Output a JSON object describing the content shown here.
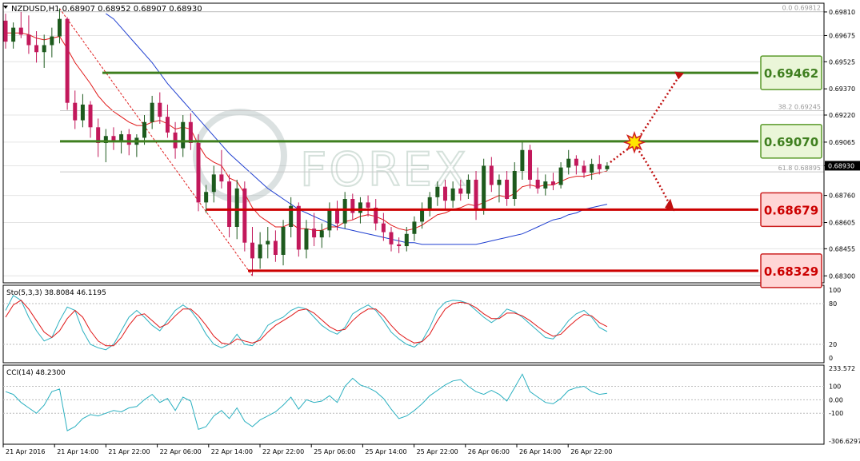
{
  "header": {
    "symbol_line": "NZDUSD,H1  0.68907 0.68952 0.68907 0.68930"
  },
  "chart_data": {
    "type": "candlestick",
    "symbol": "NZDUSD",
    "timeframe": "H1",
    "ohlc_label": "0.68907 0.68952 0.68907 0.68930",
    "ylim": [
      0.6826,
      0.6986
    ],
    "price_ticks": [
      "0.69810",
      "0.69675",
      "0.69525",
      "0.69370",
      "0.69220",
      "0.69065",
      "0.68930",
      "0.68760",
      "0.68605",
      "0.68455",
      "0.68300"
    ],
    "current_price": "0.68930",
    "x_labels": [
      "21 Apr 2016",
      "21 Apr 14:00",
      "21 Apr 22:00",
      "22 Apr 06:00",
      "22 Apr 14:00",
      "22 Apr 22:00",
      "25 Apr 06:00",
      "25 Apr 14:00",
      "25 Apr 22:00",
      "26 Apr 06:00",
      "26 Apr 14:00",
      "26 Apr 22:00"
    ],
    "fibonacci": [
      {
        "label": "0.0  0.69812",
        "price": 0.69812
      },
      {
        "label": "38.2  0.69245",
        "price": 0.69245
      },
      {
        "label": "61.8  0.68895",
        "price": 0.68895
      }
    ],
    "levels": [
      {
        "label": "0.69462",
        "price": 0.69462,
        "kind": "resistance",
        "color": "#3f7f1f",
        "fill": "#eaf6d8",
        "border": "#5a9a2a"
      },
      {
        "label": "0.69070",
        "price": 0.6907,
        "kind": "resistance",
        "color": "#3f7f1f",
        "fill": "#eaf6d8",
        "border": "#5a9a2a"
      },
      {
        "label": "0.68679",
        "price": 0.68679,
        "kind": "support",
        "color": "#cc0000",
        "fill": "#ffd6d6",
        "border": "#cc2020"
      },
      {
        "label": "0.68329",
        "price": 0.68329,
        "kind": "support",
        "color": "#cc0000",
        "fill": "#ffd6d6",
        "border": "#cc2020"
      }
    ],
    "candles": [
      [
        0.6976,
        0.698,
        0.696,
        0.6964
      ],
      [
        0.6964,
        0.6975,
        0.696,
        0.6972
      ],
      [
        0.6972,
        0.6981,
        0.6966,
        0.6968
      ],
      [
        0.6968,
        0.6979,
        0.6957,
        0.6962
      ],
      [
        0.6962,
        0.697,
        0.6952,
        0.6958
      ],
      [
        0.6958,
        0.6968,
        0.6949,
        0.6962
      ],
      [
        0.6962,
        0.6972,
        0.6955,
        0.6967
      ],
      [
        0.6967,
        0.6983,
        0.6963,
        0.6977
      ],
      [
        0.6977,
        0.6978,
        0.6925,
        0.6929
      ],
      [
        0.6929,
        0.6936,
        0.6914,
        0.6919
      ],
      [
        0.6919,
        0.6934,
        0.6915,
        0.6928
      ],
      [
        0.6928,
        0.693,
        0.6909,
        0.6915
      ],
      [
        0.6915,
        0.692,
        0.6898,
        0.6906
      ],
      [
        0.6906,
        0.6914,
        0.6895,
        0.691
      ],
      [
        0.691,
        0.6915,
        0.6902,
        0.6907
      ],
      [
        0.6907,
        0.6913,
        0.69,
        0.6911
      ],
      [
        0.6911,
        0.6914,
        0.6899,
        0.6905
      ],
      [
        0.6905,
        0.6911,
        0.6898,
        0.6909
      ],
      [
        0.6909,
        0.6922,
        0.6905,
        0.6918
      ],
      [
        0.6918,
        0.6933,
        0.6914,
        0.6929
      ],
      [
        0.6929,
        0.6935,
        0.6917,
        0.6921
      ],
      [
        0.6921,
        0.6928,
        0.6909,
        0.6912
      ],
      [
        0.6912,
        0.6918,
        0.6897,
        0.6903
      ],
      [
        0.6903,
        0.6922,
        0.6898,
        0.6918
      ],
      [
        0.6918,
        0.6923,
        0.6902,
        0.6906
      ],
      [
        0.6906,
        0.6911,
        0.6867,
        0.6872
      ],
      [
        0.6872,
        0.6882,
        0.6866,
        0.6878
      ],
      [
        0.6878,
        0.6893,
        0.6872,
        0.6888
      ],
      [
        0.6888,
        0.6902,
        0.688,
        0.6884
      ],
      [
        0.6884,
        0.6888,
        0.6852,
        0.6858
      ],
      [
        0.6858,
        0.6885,
        0.6851,
        0.688
      ],
      [
        0.688,
        0.6884,
        0.6844,
        0.6849
      ],
      [
        0.6849,
        0.6858,
        0.683,
        0.684
      ],
      [
        0.684,
        0.6855,
        0.6834,
        0.6848
      ],
      [
        0.6848,
        0.6858,
        0.684,
        0.685
      ],
      [
        0.685,
        0.6856,
        0.6838,
        0.6842
      ],
      [
        0.6842,
        0.6862,
        0.6836,
        0.6858
      ],
      [
        0.6858,
        0.6875,
        0.6852,
        0.687
      ],
      [
        0.687,
        0.6872,
        0.6841,
        0.6845
      ],
      [
        0.6845,
        0.6862,
        0.684,
        0.6857
      ],
      [
        0.6857,
        0.6866,
        0.6847,
        0.6852
      ],
      [
        0.6852,
        0.686,
        0.6846,
        0.6856
      ],
      [
        0.6856,
        0.6872,
        0.6852,
        0.6868
      ],
      [
        0.6868,
        0.6873,
        0.6856,
        0.686
      ],
      [
        0.686,
        0.6878,
        0.6857,
        0.6874
      ],
      [
        0.6874,
        0.6877,
        0.6862,
        0.6866
      ],
      [
        0.6866,
        0.6875,
        0.686,
        0.6872
      ],
      [
        0.6872,
        0.6876,
        0.6864,
        0.6869
      ],
      [
        0.6869,
        0.6874,
        0.6856,
        0.686
      ],
      [
        0.686,
        0.6866,
        0.685,
        0.6855
      ],
      [
        0.6855,
        0.6858,
        0.6844,
        0.6848
      ],
      [
        0.6848,
        0.6852,
        0.6843,
        0.6847
      ],
      [
        0.6847,
        0.6858,
        0.6844,
        0.6854
      ],
      [
        0.6854,
        0.6864,
        0.685,
        0.6861
      ],
      [
        0.6861,
        0.6872,
        0.6857,
        0.6868
      ],
      [
        0.6868,
        0.6878,
        0.6864,
        0.6875
      ],
      [
        0.6875,
        0.6884,
        0.687,
        0.6881
      ],
      [
        0.6881,
        0.6885,
        0.6868,
        0.6873
      ],
      [
        0.6873,
        0.6884,
        0.6869,
        0.688
      ],
      [
        0.688,
        0.6885,
        0.6873,
        0.6877
      ],
      [
        0.6877,
        0.6888,
        0.6874,
        0.6885
      ],
      [
        0.6885,
        0.689,
        0.6862,
        0.6868
      ],
      [
        0.6868,
        0.6897,
        0.6865,
        0.6893
      ],
      [
        0.6893,
        0.6898,
        0.6878,
        0.6882
      ],
      [
        0.6882,
        0.6888,
        0.6872,
        0.6885
      ],
      [
        0.6885,
        0.689,
        0.687,
        0.6874
      ],
      [
        0.6874,
        0.6895,
        0.687,
        0.689
      ],
      [
        0.689,
        0.6907,
        0.6885,
        0.6902
      ],
      [
        0.6902,
        0.6905,
        0.688,
        0.6885
      ],
      [
        0.6885,
        0.6892,
        0.6877,
        0.688
      ],
      [
        0.688,
        0.6888,
        0.6876,
        0.6884
      ],
      [
        0.6884,
        0.6889,
        0.6879,
        0.6882
      ],
      [
        0.6882,
        0.6895,
        0.688,
        0.6892
      ],
      [
        0.6892,
        0.6902,
        0.6888,
        0.6897
      ],
      [
        0.6897,
        0.6899,
        0.6888,
        0.6893
      ],
      [
        0.6893,
        0.6896,
        0.6886,
        0.6889
      ],
      [
        0.6889,
        0.6897,
        0.6885,
        0.6894
      ],
      [
        0.6894,
        0.6899,
        0.6888,
        0.6891
      ],
      [
        0.6891,
        0.6895,
        0.689,
        0.6893
      ]
    ],
    "ma_red": [
      0.6969,
      0.6969,
      0.6969,
      0.6968,
      0.6966,
      0.6965,
      0.6966,
      0.6967,
      0.696,
      0.6952,
      0.6946,
      0.694,
      0.6933,
      0.6928,
      0.6924,
      0.6921,
      0.6918,
      0.6916,
      0.6916,
      0.6918,
      0.6919,
      0.6917,
      0.6914,
      0.6915,
      0.6914,
      0.6905,
      0.6898,
      0.6895,
      0.6893,
      0.6886,
      0.6884,
      0.6877,
      0.6869,
      0.6864,
      0.6861,
      0.6858,
      0.6858,
      0.686,
      0.6857,
      0.6857,
      0.6856,
      0.6856,
      0.6858,
      0.6858,
      0.6861,
      0.6862,
      0.6864,
      0.6865,
      0.6864,
      0.6862,
      0.6859,
      0.6857,
      0.6856,
      0.6857,
      0.6859,
      0.6862,
      0.6865,
      0.6866,
      0.6868,
      0.6869,
      0.6871,
      0.687,
      0.6872,
      0.6874,
      0.6876,
      0.6875,
      0.6877,
      0.6881,
      0.6882,
      0.6881,
      0.6882,
      0.6882,
      0.6884,
      0.6886,
      0.6887,
      0.6887,
      0.6888,
      0.6889,
      0.689
    ],
    "ma_blue": [
      null,
      null,
      null,
      null,
      null,
      null,
      null,
      null,
      null,
      null,
      null,
      null,
      null,
      0.698,
      0.6977,
      0.6972,
      0.6967,
      0.6962,
      0.6957,
      0.6952,
      0.6946,
      0.694,
      0.6935,
      0.693,
      0.6925,
      0.692,
      0.6915,
      0.691,
      0.6905,
      0.69,
      0.6896,
      0.6892,
      0.6888,
      0.6884,
      0.688,
      0.6877,
      0.6874,
      0.6871,
      0.6868,
      0.6866,
      0.6864,
      0.6862,
      0.686,
      0.6858,
      0.6857,
      0.6856,
      0.6855,
      0.6854,
      0.6853,
      0.6852,
      0.6851,
      0.685,
      0.6849,
      0.6849,
      0.6848,
      0.6848,
      0.6848,
      0.6848,
      0.6848,
      0.6848,
      0.6848,
      0.6848,
      0.6849,
      0.685,
      0.6851,
      0.6852,
      0.6853,
      0.6854,
      0.6856,
      0.6858,
      0.686,
      0.6862,
      0.6863,
      0.6865,
      0.6866,
      0.6868,
      0.6869,
      0.687,
      0.6871
    ],
    "stochastic": {
      "label": "Sto(5,3,3) 38.8084 46.1195",
      "ylim": [
        0,
        100
      ],
      "ticks": [
        "100",
        "80",
        "20",
        "0"
      ],
      "main": [
        70,
        92,
        85,
        60,
        40,
        25,
        30,
        55,
        75,
        70,
        40,
        20,
        15,
        12,
        20,
        40,
        60,
        70,
        60,
        48,
        40,
        55,
        70,
        78,
        70,
        55,
        35,
        20,
        15,
        20,
        35,
        20,
        18,
        30,
        48,
        55,
        60,
        70,
        75,
        72,
        60,
        48,
        40,
        35,
        45,
        65,
        72,
        78,
        70,
        55,
        38,
        28,
        20,
        16,
        25,
        45,
        70,
        82,
        85,
        84,
        80,
        70,
        60,
        52,
        60,
        72,
        68,
        60,
        50,
        40,
        30,
        28,
        40,
        55,
        65,
        70,
        60,
        45,
        38.8
      ],
      "signal": [
        60,
        78,
        85,
        72,
        55,
        38,
        30,
        40,
        58,
        70,
        60,
        40,
        25,
        18,
        18,
        30,
        48,
        62,
        65,
        55,
        45,
        50,
        62,
        72,
        72,
        62,
        48,
        32,
        22,
        20,
        28,
        25,
        22,
        26,
        38,
        48,
        55,
        62,
        70,
        72,
        66,
        56,
        46,
        40,
        42,
        55,
        65,
        72,
        72,
        62,
        48,
        36,
        28,
        22,
        24,
        35,
        55,
        72,
        80,
        82,
        80,
        74,
        65,
        58,
        58,
        66,
        66,
        62,
        55,
        46,
        38,
        32,
        35,
        46,
        56,
        64,
        62,
        52,
        46.1
      ]
    },
    "cci": {
      "label": "CCI(14) 48.2300",
      "ylim": [
        -306.6297,
        233.572
      ],
      "ticks": [
        "233.572",
        "100",
        "0.00",
        "-100",
        "-306.6297"
      ],
      "values": [
        60,
        40,
        -20,
        -60,
        -100,
        -40,
        60,
        80,
        -230,
        -200,
        -140,
        -110,
        -120,
        -100,
        -80,
        -90,
        -60,
        -50,
        0,
        40,
        -20,
        10,
        -80,
        20,
        -10,
        -220,
        -200,
        -120,
        -80,
        -140,
        -60,
        -160,
        -200,
        -150,
        -120,
        -90,
        -40,
        20,
        -70,
        0,
        -20,
        -10,
        30,
        -20,
        100,
        160,
        110,
        90,
        60,
        10,
        -70,
        -140,
        -120,
        -80,
        -30,
        30,
        70,
        110,
        140,
        150,
        100,
        60,
        40,
        70,
        40,
        -10,
        90,
        190,
        60,
        20,
        -20,
        -30,
        10,
        70,
        90,
        100,
        60,
        40,
        48
      ]
    }
  }
}
